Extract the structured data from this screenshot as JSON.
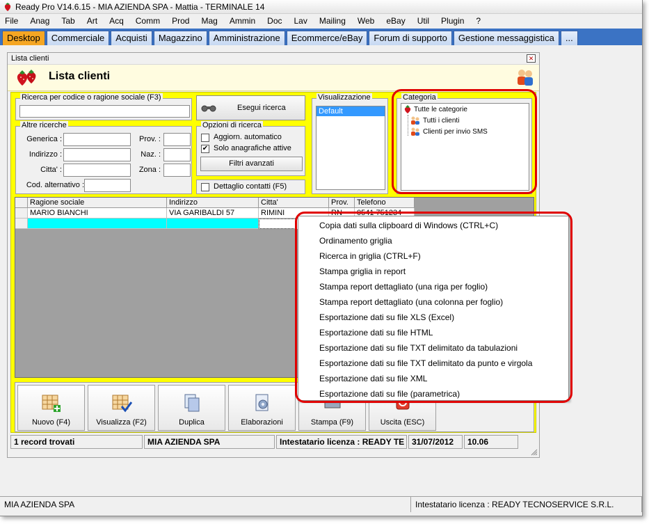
{
  "app": {
    "title": "Ready Pro V14.6.15 - MIA AZIENDA SPA - Mattia - TERMINALE 14"
  },
  "menu": [
    "File",
    "Anag",
    "Tab",
    "Art",
    "Acq",
    "Comm",
    "Prod",
    "Mag",
    "Ammin",
    "Doc",
    "Lav",
    "Mailing",
    "Web",
    "eBay",
    "Util",
    "Plugin",
    "?"
  ],
  "tabs": [
    {
      "label": "Desktop",
      "active": true
    },
    {
      "label": "Commerciale"
    },
    {
      "label": "Acquisti"
    },
    {
      "label": "Magazzino"
    },
    {
      "label": "Amministrazione"
    },
    {
      "label": "Ecommerce/eBay"
    },
    {
      "label": "Forum di supporto"
    },
    {
      "label": "Gestione messaggistica"
    },
    {
      "label": "..."
    }
  ],
  "window": {
    "caption": "Lista clienti",
    "header_title": "Lista clienti"
  },
  "search": {
    "main_group": "Ricerca per codice o ragione sociale (F3)",
    "main_value": "",
    "run_button": "Esegui ricerca",
    "other_group": "Altre ricerche",
    "fields": {
      "generica": "Generica :",
      "indirizzo": "Indirizzo :",
      "citta": "Citta' :",
      "cod_alt": "Cod. alternativo :",
      "prov": "Prov. :",
      "naz": "Naz. :",
      "zona": "Zona :"
    },
    "options_group": "Opzioni di ricerca",
    "opt_auto": "Aggiorn. automatico",
    "opt_auto_checked": false,
    "opt_active": "Solo anagrafiche attive",
    "opt_active_checked": true,
    "advanced_filters": "Filtri avanzati",
    "contact_detail": "Dettaglio contatti (F5)",
    "contact_detail_checked": false
  },
  "visualizzazione": {
    "label": "Visualizzazione",
    "selected": "Default"
  },
  "categoria": {
    "label": "Categoria",
    "root": "Tutte le categorie",
    "children": [
      "Tutti i clienti",
      "Clienti per invio SMS"
    ]
  },
  "grid": {
    "columns": [
      "Ragione sociale",
      "Indirizzo",
      "Citta'",
      "Prov.",
      "Telefono"
    ],
    "rows": [
      [
        "MARIO BIANCHI",
        "VIA GARIBALDI 57",
        "RIMINI",
        "RN",
        "0541 751234"
      ]
    ]
  },
  "context_menu": [
    "Copia dati sulla clipboard di Windows (CTRL+C)",
    "Ordinamento griglia",
    "Ricerca in griglia (CTRL+F)",
    "Stampa griglia in report",
    "Stampa report dettagliato (una riga per foglio)",
    "Stampa report dettagliato (una colonna per foglio)",
    "Esportazione dati su file XLS (Excel)",
    "Esportazione dati su file HTML",
    "Esportazione dati su file TXT delimitato da tabulazioni",
    "Esportazione dati su file TXT delimitato da punto e virgola",
    "Esportazione dati su file XML",
    "Esportazione dati su file (parametrica)"
  ],
  "toolbar": {
    "nuovo": "Nuovo (F4)",
    "visualizza": "Visualizza (F2)",
    "duplica": "Duplica",
    "elaborazioni": "Elaborazioni",
    "stampa": "Stampa (F9)",
    "uscita": "Uscita (ESC)"
  },
  "child_status": {
    "records": "1 record trovati",
    "company": "MIA AZIENDA SPA",
    "license": "Intestatario licenza : READY TE",
    "date": "31/07/2012",
    "time": "10.06"
  },
  "app_status": {
    "company": "MIA AZIENDA SPA",
    "license": "Intestatario licenza : READY TECNOSERVICE S.R.L."
  },
  "colors": {
    "tab_bar": "#3b73c4",
    "active_tab": "#f5a623",
    "panel_yellow": "#ffff00",
    "highlight_red": "#e00000",
    "selection_blue": "#3399ff",
    "new_row_cyan": "#00ffff"
  }
}
